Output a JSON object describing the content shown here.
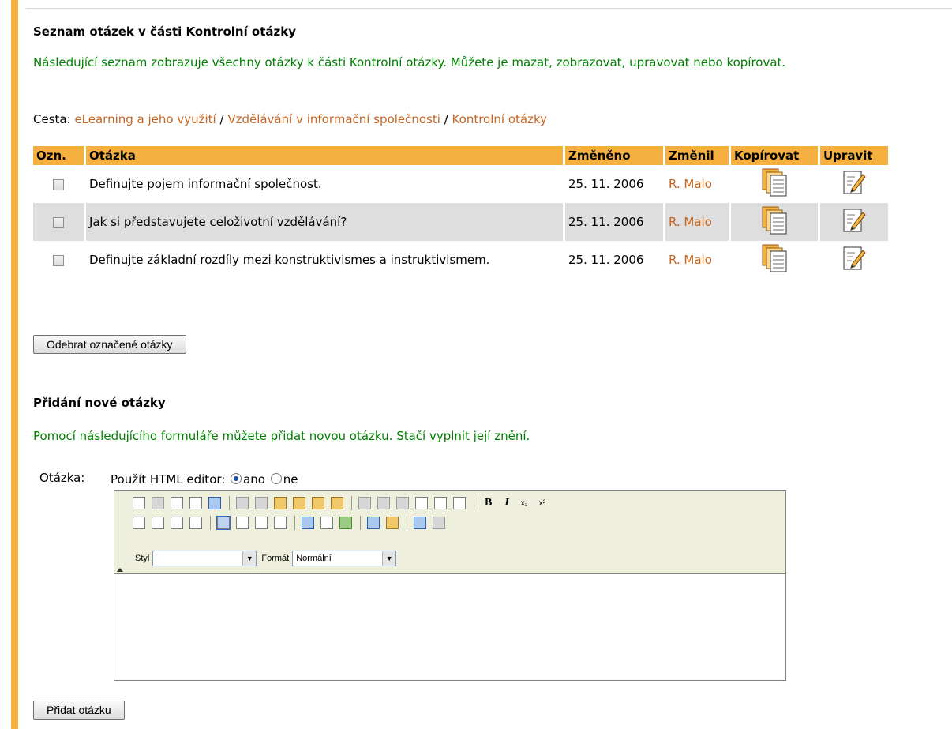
{
  "list": {
    "title": "Seznam otázek v části Kontrolní otázky",
    "description": "Následující seznam zobrazuje všechny otázky k části Kontrolní otázky. Můžete je mazat, zobrazovat, upravovat nebo kopírovat.",
    "path_label": "Cesta:",
    "path_sep": " / ",
    "path": [
      "eLearning a jeho využití",
      "Vzdělávání v informační společnosti",
      "Kontrolní otázky"
    ],
    "columns": [
      "Ozn.",
      "Otázka",
      "Změněno",
      "Změnil",
      "Kopírovat",
      "Upravit"
    ],
    "rows": [
      {
        "question": "Definujte pojem informační společnost.",
        "date": "25. 11. 2006",
        "user": "R. Malo"
      },
      {
        "question": "Jak si představujete celoživotní vzdělávání?",
        "date": "25. 11. 2006",
        "user": "R. Malo"
      },
      {
        "question": "Definujte základní rozdíly mezi konstruktivismes a instruktivismem.",
        "date": "25. 11. 2006",
        "user": "R. Malo"
      }
    ],
    "remove_button": "Odebrat označené otázky"
  },
  "add": {
    "title": "Přidání nové otázky",
    "description": "Pomocí následujícího formuláře můžete přidat novou otázku. Stačí vyplnit její znění.",
    "question_label": "Otázka:",
    "html_editor_label": "Použít HTML editor:",
    "option_yes": "ano",
    "option_no": "ne",
    "html_editor_selected": "ano",
    "style_label": "Styl",
    "style_value": "",
    "format_label": "Formát",
    "format_value": "Normální",
    "submit_button": "Přidat otázku"
  },
  "editor_toolbar": {
    "bold": "B",
    "italic": "I",
    "subscript": "x₂",
    "superscript": "x²"
  },
  "colors": {
    "accent": "#f6b040",
    "link": "#c8641e",
    "description_text": "#008000",
    "row_alt": "#dedede"
  }
}
